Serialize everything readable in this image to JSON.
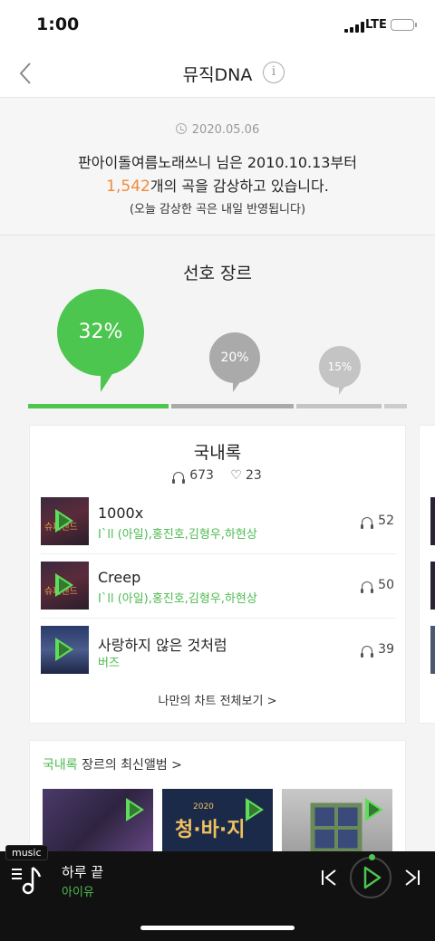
{
  "status": {
    "time": "1:00",
    "network": "LTE"
  },
  "nav": {
    "title": "뮤직DNA"
  },
  "summary": {
    "date": "2020.05.06",
    "line1": "판아이돌여름노래쓰니 님은 2010.10.13부터",
    "count": "1,542",
    "line2_rest": "개의 곡을 감상하고 있습니다.",
    "note": "(오늘 감상한 곡은 내일 반영됩니다)"
  },
  "genre_section": {
    "title": "선호 장르",
    "bubbles": [
      {
        "label": "32%",
        "share": 0.32,
        "color": "#4cc64f"
      },
      {
        "label": "20%",
        "share": 0.2,
        "color": "#aaaaaa"
      },
      {
        "label": "15%",
        "share": 0.15,
        "color": "#c4c4c4"
      }
    ],
    "bar_colors": [
      "#4cc64f",
      "#aaaaaa",
      "#c4c4c4",
      "#cccccc"
    ],
    "bar_shares": [
      0.38,
      0.33,
      0.23,
      0.06
    ]
  },
  "genre_card": {
    "genre": "국내록",
    "plays": "673",
    "likes": "23",
    "songs": [
      {
        "title": "1000x",
        "artist": "I`ll (아일),홍진호,김형우,하현상",
        "count": "52"
      },
      {
        "title": "Creep",
        "artist": "I`ll (아일),홍진호,김형우,하현상",
        "count": "50"
      },
      {
        "title": "사랑하지 않은 것처럼",
        "artist": "버즈",
        "count": "39"
      }
    ],
    "chart_link": "나만의 차트 전체보기 >"
  },
  "albums": {
    "genre": "국내록",
    "header_rest": " 장르의 최신앨범 >",
    "items": [
      {
        "name": "album-1"
      },
      {
        "name": "album-2",
        "art_text": "청·바·지",
        "art_year": "2020"
      },
      {
        "name": "album-3"
      }
    ]
  },
  "player": {
    "badge": "music",
    "title": "하루 끝",
    "artist": "아이유"
  },
  "colors": {
    "accent": "#4cc64f",
    "count": "#f2893a"
  }
}
